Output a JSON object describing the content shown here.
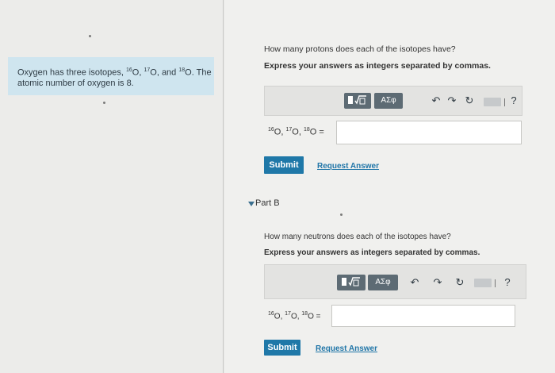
{
  "context": {
    "line1_prefix": "Oxygen has three isotopes, ",
    "iso1_mass": "16",
    "iso2_mass": "17",
    "iso3_mass": "18",
    "element_symbol": "O",
    "and": "and",
    "line1_suffix": ". The",
    "line2": "atomic number of oxygen is 8."
  },
  "part_a": {
    "question": "How many protons does each of the isotopes have?",
    "instruction": "Express your answers as integers separated by commas.",
    "answer_label": {
      "mass1": "16",
      "mass2": "17",
      "mass3": "18",
      "symbol": "O",
      "equals": "="
    },
    "answer_value": "",
    "submit_label": "Submit",
    "request_label": "Request Answer"
  },
  "part_b": {
    "header": "Part B",
    "question": "How many neutrons does each of the isotopes have?",
    "instruction": "Express your answers as integers separated by commas.",
    "answer_label": {
      "mass1": "16",
      "mass2": "17",
      "mass3": "18",
      "symbol": "O",
      "equals": "="
    },
    "answer_value": "",
    "submit_label": "Submit",
    "request_label": "Request Answer"
  },
  "toolbar": {
    "symbols_label": "ΑΣφ",
    "help_label": "?",
    "icons": [
      "templates-icon",
      "sqrt-icon",
      "undo-icon",
      "redo-icon",
      "reset-icon",
      "keyboard-icon",
      "help-icon"
    ]
  },
  "colors": {
    "context_bg": "#cfe5ef",
    "submit_bg": "#1f78a8",
    "link": "#2176a8",
    "toolbar_button": "#5d6b74"
  }
}
